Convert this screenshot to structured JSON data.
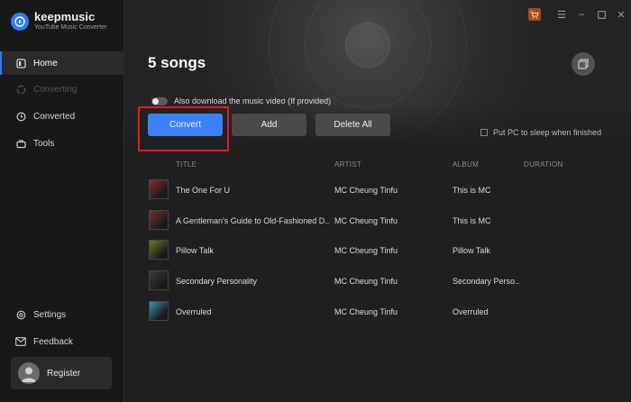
{
  "app": {
    "name": "keepmusic",
    "subtitle": "YouTube Music Converter"
  },
  "sidebar": {
    "items": [
      {
        "label": "Home",
        "icon": "home-icon",
        "state": "active"
      },
      {
        "label": "Converting",
        "icon": "converting-icon",
        "state": "disabled"
      },
      {
        "label": "Converted",
        "icon": "clock-icon",
        "state": "normal"
      },
      {
        "label": "Tools",
        "icon": "toolbox-icon",
        "state": "normal"
      }
    ],
    "bottom": [
      {
        "label": "Settings",
        "icon": "gear-icon"
      },
      {
        "label": "Feedback",
        "icon": "mail-icon"
      }
    ],
    "register_label": "Register"
  },
  "main": {
    "title": "5 songs",
    "video_toggle_label": "Also download the music video (If provided)",
    "buttons": {
      "convert": "Convert",
      "add": "Add",
      "delete_all": "Delete All"
    },
    "sleep_label": "Put PC to sleep when finished"
  },
  "table": {
    "columns": [
      "TITLE",
      "ARTIST",
      "ALBUM",
      "DURATION"
    ],
    "rows": [
      {
        "title": "The One For U",
        "artist": "MC Cheung Tinfu",
        "album": "This is MC",
        "duration": "",
        "thumb_color": "#8a2a2a"
      },
      {
        "title": "A Gentleman's Guide to Old-Fashioned D...",
        "artist": "MC Cheung Tinfu",
        "album": "This is MC",
        "duration": "",
        "thumb_color": "#7a3030"
      },
      {
        "title": "Pillow Talk",
        "artist": "MC Cheung Tinfu",
        "album": "Pillow Talk",
        "duration": "",
        "thumb_color": "#6a7a2a"
      },
      {
        "title": "Secondary Personality",
        "artist": "MC Cheung Tinfu",
        "album": "Secondary Perso...",
        "duration": "",
        "thumb_color": "#3a3a3a"
      },
      {
        "title": "Overruled",
        "artist": "MC Cheung Tinfu",
        "album": "Overruled",
        "duration": "",
        "thumb_color": "#3d8fb0"
      }
    ]
  },
  "colors": {
    "accent": "#3b82f6",
    "highlight": "#e31b1b",
    "cart": "#a14c1f"
  }
}
